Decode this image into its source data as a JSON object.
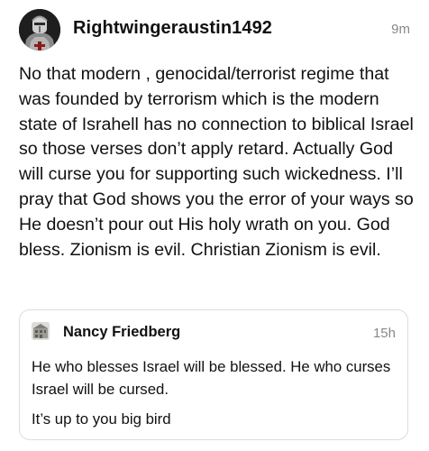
{
  "post": {
    "author": "Rightwingeraustin1492",
    "time": "9m",
    "body": "No that modern , genocidal/terrorist regime that was founded by terrorism which is the modern state of Israhell has no connection to biblical Israel so those verses don’t apply retard.  Actually God will curse you for supporting such wickedness.  I’ll pray that God shows you the error of your ways so He doesn’t pour out His holy wrath on you. God bless.  Zionism is evil.  Christian Zionism is evil."
  },
  "quoted": {
    "author": "Nancy Friedberg",
    "time": "15h",
    "body_1": "He who blesses Israel will be blessed.  He who curses Israel will be cursed.",
    "body_2": "It’s up to you big bird"
  },
  "icons": {
    "author_avatar": "armored-knight-avatar",
    "quoted_avatar": "building-photo-avatar"
  }
}
